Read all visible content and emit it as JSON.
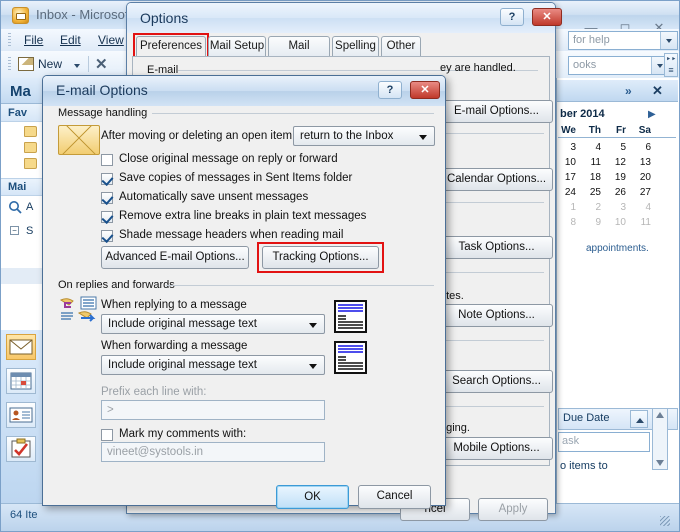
{
  "outlook": {
    "title": "Inbox - Microsoft",
    "menus": [
      "File",
      "Edit",
      "View"
    ],
    "toolbar": {
      "new_label": "New"
    },
    "help_placeholder": "for help",
    "books_placeholder": "ooks",
    "nav": {
      "header": "Ma",
      "favorites": "Fav",
      "mail_group": "Mai",
      "search_label": "A",
      "tree_label": "S"
    },
    "status": "64 Ite",
    "todo_bar": {
      "calendar_title": "ber 2014",
      "day_headers": [
        "We",
        "Th",
        "Fr",
        "Sa"
      ],
      "weeks": [
        [
          {
            "d": "3",
            "m": false
          },
          {
            "d": "4",
            "m": false
          },
          {
            "d": "5",
            "m": false
          },
          {
            "d": "6",
            "m": false
          }
        ],
        [
          {
            "d": "10",
            "m": false
          },
          {
            "d": "11",
            "m": false
          },
          {
            "d": "12",
            "m": false
          },
          {
            "d": "13",
            "m": false
          }
        ],
        [
          {
            "d": "17",
            "m": false
          },
          {
            "d": "18",
            "m": false
          },
          {
            "d": "19",
            "m": false
          },
          {
            "d": "20",
            "m": false
          }
        ],
        [
          {
            "d": "24",
            "m": false
          },
          {
            "d": "25",
            "m": false
          },
          {
            "d": "26",
            "m": false
          },
          {
            "d": "27",
            "m": false
          }
        ],
        [
          {
            "d": "1",
            "m": true
          },
          {
            "d": "2",
            "m": true
          },
          {
            "d": "3",
            "m": true
          },
          {
            "d": "4",
            "m": true
          }
        ],
        [
          {
            "d": "8",
            "m": true
          },
          {
            "d": "9",
            "m": true
          },
          {
            "d": "10",
            "m": true
          },
          {
            "d": "11",
            "m": true
          }
        ]
      ],
      "appointments_text": "appointments.",
      "due_date": "Due Date",
      "task_placeholder": "ask",
      "no_items": "o items to"
    }
  },
  "options_dialog": {
    "title": "Options",
    "tabs": [
      {
        "label": "Preferences",
        "active": true
      },
      {
        "label": "Mail Setup",
        "active": false
      },
      {
        "label": "Mail Format",
        "active": false
      },
      {
        "label": "Spelling",
        "active": false
      },
      {
        "label": "Other",
        "active": false
      }
    ],
    "group_email": "E-mail",
    "desc_handled": "ey are handled.",
    "desc_notes": "otes.",
    "desc_aging": "aging.",
    "buttons": {
      "email_options": "E-mail Options...",
      "calendar_options": "Calendar Options...",
      "task_options": "Task Options...",
      "note_options": "Note Options...",
      "search_options": "Search Options...",
      "mobile_options": "Mobile Options...",
      "cancel": "ncel",
      "apply": "Apply"
    },
    "highlight_color": "#e21212"
  },
  "email_options_dialog": {
    "title": "E-mail Options",
    "group_message_handling": "Message handling",
    "group_replies": "On replies and forwards",
    "after_move_label": "After moving or deleting an open item:",
    "after_move_value": "return to the Inbox",
    "checkboxes": [
      {
        "label": "Close original message on reply or forward",
        "checked": false
      },
      {
        "label": "Save copies of messages in Sent Items folder",
        "checked": true
      },
      {
        "label": "Automatically save unsent messages",
        "checked": true
      },
      {
        "label": "Remove extra line breaks in plain text messages",
        "checked": true
      },
      {
        "label": "Shade message headers when reading mail",
        "checked": true
      }
    ],
    "advanced_button": "Advanced E-mail Options...",
    "tracking_button": "Tracking Options...",
    "replying_label": "When replying to a message",
    "replying_value": "Include original message text",
    "forwarding_label": "When forwarding a message",
    "forwarding_value": "Include original message text",
    "prefix_label": "Prefix each line with:",
    "prefix_value": ">",
    "mark_comments_label": "Mark my comments with:",
    "mark_comments_value": "vineet@systools.in",
    "mark_comments_checked": false,
    "ok_button": "OK",
    "cancel_button": "Cancel"
  }
}
